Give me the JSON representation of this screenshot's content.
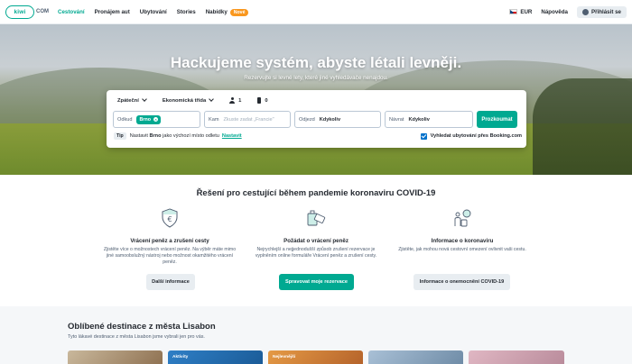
{
  "header": {
    "logo": "kiwi",
    "logo_suffix": "COM",
    "nav": [
      {
        "label": "Cestování",
        "active": true
      },
      {
        "label": "Pronájem aut",
        "active": false
      },
      {
        "label": "Ubytování",
        "active": false
      },
      {
        "label": "Stories",
        "active": false
      },
      {
        "label": "Nabídky",
        "active": false
      }
    ],
    "new_badge": "Nové",
    "currency": "EUR",
    "help": "Nápověda",
    "login": "Přihlásit se"
  },
  "hero": {
    "title": "Hackujeme systém, abyste létali levněji.",
    "subtitle": "Rezervujte si levné lety, které jiné vyhledávače nenajdou."
  },
  "search": {
    "trip_type": "Zpáteční",
    "cabin": "Ekonomická třída",
    "passengers": "1",
    "bags": "0",
    "from_label": "Odkud",
    "from_value": "Brno",
    "to_label": "Kam",
    "to_placeholder": "Zkuste zadat „Francie\"",
    "depart_label": "Odjezd",
    "depart_value": "Kdykoliv",
    "return_label": "Návrat",
    "return_value": "Kdykoliv",
    "explore_button": "Prozkoumat",
    "tip_tag": "Tip",
    "tip_pre": "Nastavit",
    "tip_city": "Brno",
    "tip_post": "jako výchozí místo odletu",
    "tip_link": "Nastavit",
    "booking_label": "Vyhledat ubytování přes Booking.com",
    "booking_checked": true
  },
  "covid": {
    "title": "Řešení pro cestující během pandemie koronaviru COVID-19",
    "columns": [
      {
        "icon": "refund-shield-icon",
        "title": "Vrácení peněz a zrušení cesty",
        "text": "Zjistěte více o možnostech vrácení peněz. Na výběr máte mimo jiné samoobslužný nástroj nebo možnost okamžitého vrácení peněz.",
        "button": "Další informace"
      },
      {
        "icon": "luggage-ticket-icon",
        "title": "Požádat o vrácení peněz",
        "text": "Nejrychlejší a nejjednodušší způsob zrušení rezervace je vyplněním online formuláře Vrácení peněz a zrušení cesty.",
        "button": "Spravovat moje rezervace"
      },
      {
        "icon": "traveler-virus-icon",
        "title": "Informace o koronaviru",
        "text": "Zjistěte, jak mohou nová cestovní omezení ovlivnit vaši cestu.",
        "button": "Informace o onemocnění COVID-19"
      }
    ]
  },
  "popular": {
    "title": "Oblíbené destinace z města Lisabon",
    "subtitle": "Tyto lákavé destinace z města Lisabon jsme vybrali jen pro vás.",
    "cards": [
      {
        "tag": ""
      },
      {
        "tag": "Aktivity"
      },
      {
        "tag": "Nejlevnější"
      },
      {
        "tag": ""
      },
      {
        "tag": ""
      }
    ]
  },
  "colors": {
    "brand": "#00a991",
    "new_badge": "#f9971e",
    "booking_checkbox": "#0172cb"
  }
}
